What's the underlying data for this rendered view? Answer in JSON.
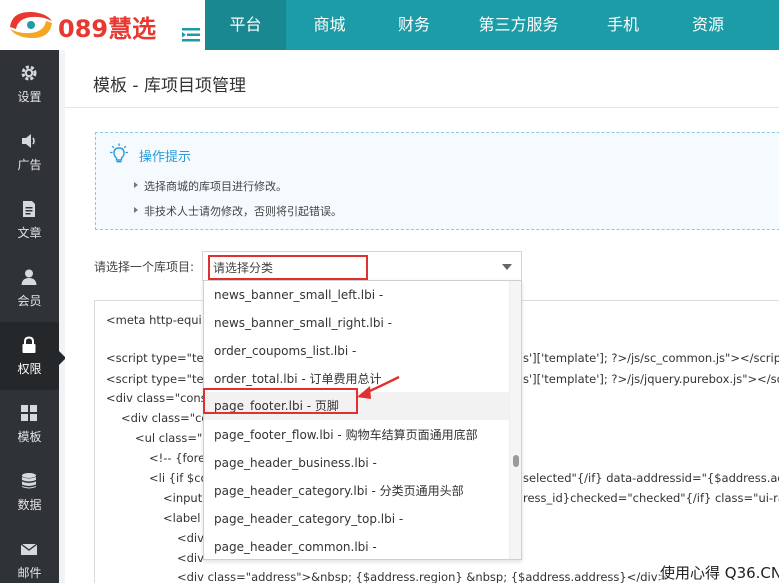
{
  "brand": {
    "logo_text": "089慧选"
  },
  "nav": [
    {
      "label": "平台",
      "active": true
    },
    {
      "label": "商城",
      "active": false
    },
    {
      "label": "财务",
      "active": false
    },
    {
      "label": "第三方服务",
      "active": false
    },
    {
      "label": "手机",
      "active": false
    },
    {
      "label": "资源",
      "active": false
    }
  ],
  "sidebar": [
    {
      "label": "设置",
      "icon": "gear-icon"
    },
    {
      "label": "广告",
      "icon": "speaker-icon"
    },
    {
      "label": "文章",
      "icon": "article-icon"
    },
    {
      "label": "会员",
      "icon": "user-icon"
    },
    {
      "label": "权限",
      "icon": "lock-icon",
      "active": true
    },
    {
      "label": "模板",
      "icon": "grid-icon"
    },
    {
      "label": "数据",
      "icon": "database-icon"
    },
    {
      "label": "邮件",
      "icon": "mail-icon"
    }
  ],
  "page": {
    "title": "模板 - 库项目项管理"
  },
  "tips": {
    "title": "操作提示",
    "lines": [
      "选择商城的库项目进行修改。",
      "非技术人士请勿修改，否则将引起错误。"
    ]
  },
  "select": {
    "label": "请选择一个库项目:",
    "value": "请选择分类"
  },
  "dropdown": {
    "items": [
      "news_banner_small_left.lbi -",
      "news_banner_small_right.lbi -",
      "order_coupoms_list.lbi -",
      "order_total.lbi - 订单费用总计",
      "page_footer.lbi - 页脚",
      "page_footer_flow.lbi - 购物车结算页面通用底部",
      "page_header_business.lbi -",
      "page_header_category.lbi - 分类页通用头部",
      "page_header_category_top.lbi -",
      "page_header_common.lbi -"
    ],
    "highlighted_index": 4
  },
  "code": {
    "lines": [
      "<meta http-equi",
      "<script type=\"te",
      "<script type=\"te",
      "<div class=\"cons",
      "<div class=\"co",
      "<ul class=\"u",
      "<!-- {fore",
      "<li {if $co",
      "<input",
      "<label",
      "<div",
      "<div",
      "<div class=\"address\">&nbsp; {$address.region} &nbsp; {$address.address}</div>"
    ],
    "right_fragments": [
      "s']['template']; ?>/js/sc_common.js\"></script",
      "s']['template']; ?>/js/jquery.purebox.js\"></scr",
      "selected\"{/if} data-addressid=\"{$address.add",
      "ress_id}checked=\"checked\"{/if} class=\"ui-rad"
    ]
  },
  "watermark": "使用心得 Q36.CN",
  "colors": {
    "topbar": "#1c9ca6",
    "sidebar": "#2f3236",
    "highlight": "#e23030",
    "tips_title": "#2d9bd6"
  }
}
